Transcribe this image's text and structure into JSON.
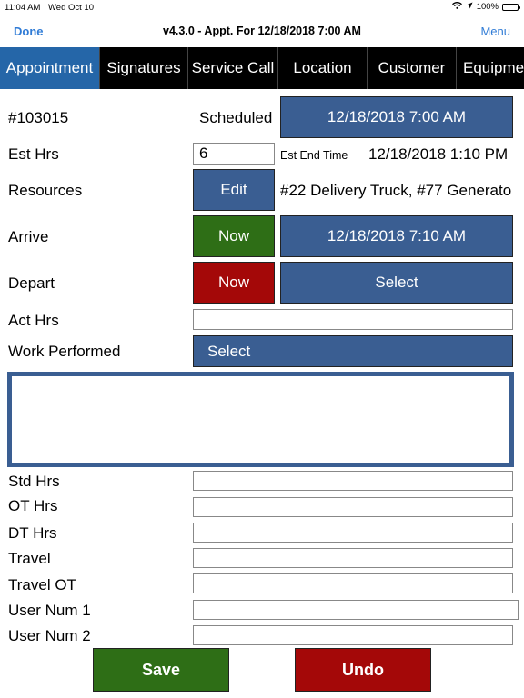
{
  "status_bar": {
    "time": "11:04 AM",
    "date": "Wed Oct 10",
    "battery": "100%"
  },
  "nav": {
    "done": "Done",
    "title": "v4.3.0 - Appt. For 12/18/2018 7:00 AM",
    "menu": "Menu"
  },
  "tabs": [
    "Appointment",
    "Signatures",
    "Service Call",
    "Location",
    "Customer",
    "Equipme"
  ],
  "appointment": {
    "number": "#103015",
    "status": "Scheduled",
    "scheduled_datetime": "12/18/2018 7:00 AM",
    "est_hrs_label": "Est Hrs",
    "est_hrs_value": "6",
    "est_end_label": "Est End Time",
    "est_end_value": "12/18/2018 1:10 PM",
    "resources_label": "Resources",
    "edit_label": "Edit",
    "resources_value": "#22 Delivery Truck, #77 Generato",
    "arrive_label": "Arrive",
    "arrive_now": "Now",
    "arrive_value": "12/18/2018 7:10 AM",
    "depart_label": "Depart",
    "depart_now": "Now",
    "depart_select": "Select",
    "act_hrs_label": "Act Hrs",
    "work_performed_label": "Work Performed",
    "work_select": "Select",
    "std_hrs_label": "Std Hrs",
    "ot_hrs_label": "OT Hrs",
    "dt_hrs_label": "DT Hrs",
    "travel_label": "Travel",
    "travel_ot_label": "Travel OT",
    "user_num1_label": "User Num 1",
    "user_num2_label": "User Num 2"
  },
  "actions": {
    "save": "Save",
    "undo": "Undo"
  },
  "colors": {
    "nav_blue": "#2f7bd6",
    "tab_active": "#2566a8",
    "button_blue": "#3a5e92",
    "green": "#2e6e16",
    "red": "#a40808"
  }
}
